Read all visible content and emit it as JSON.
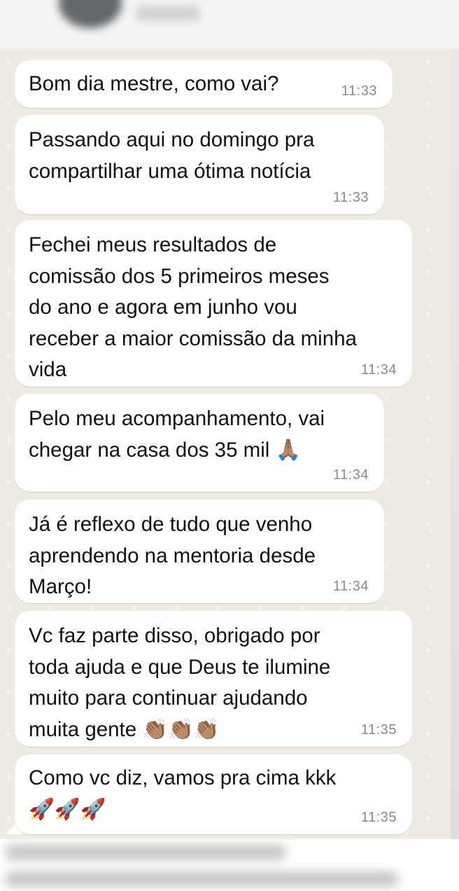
{
  "header": {
    "contact_avatar": "blurred-avatar",
    "contact_name": ""
  },
  "messages": [
    {
      "text": "Bom dia mestre, como vai?",
      "time": "11:33"
    },
    {
      "text": "Passando aqui no domingo pra\ncompartilhar uma ótima notícia",
      "time": "11:33"
    },
    {
      "text": "Fechei meus resultados de\ncomissão dos 5 primeiros meses\ndo ano e agora em junho vou\nreceber a maior comissão da minha\nvida",
      "time": "11:34"
    },
    {
      "text": "Pelo meu acompanhamento, vai\nchegar na casa dos 35 mil 🙏🏽",
      "time": "11:34"
    },
    {
      "text": "Já é reflexo de tudo que venho\naprendendo na mentoria desde\nMarço!",
      "time": "11:34"
    },
    {
      "text": "Vc faz parte disso, obrigado por\ntoda ajuda e que Deus te ilumine\nmuito para continuar ajudando\nmuita gente 👏🏽👏🏽👏🏽",
      "time": "11:35"
    },
    {
      "text": "Como vc diz, vamos pra cima kkk\n🚀🚀🚀",
      "time": "11:35"
    }
  ],
  "colors": {
    "chat_background": "#efeae2",
    "bubble": "#ffffff",
    "time": "#8a8a8a"
  }
}
